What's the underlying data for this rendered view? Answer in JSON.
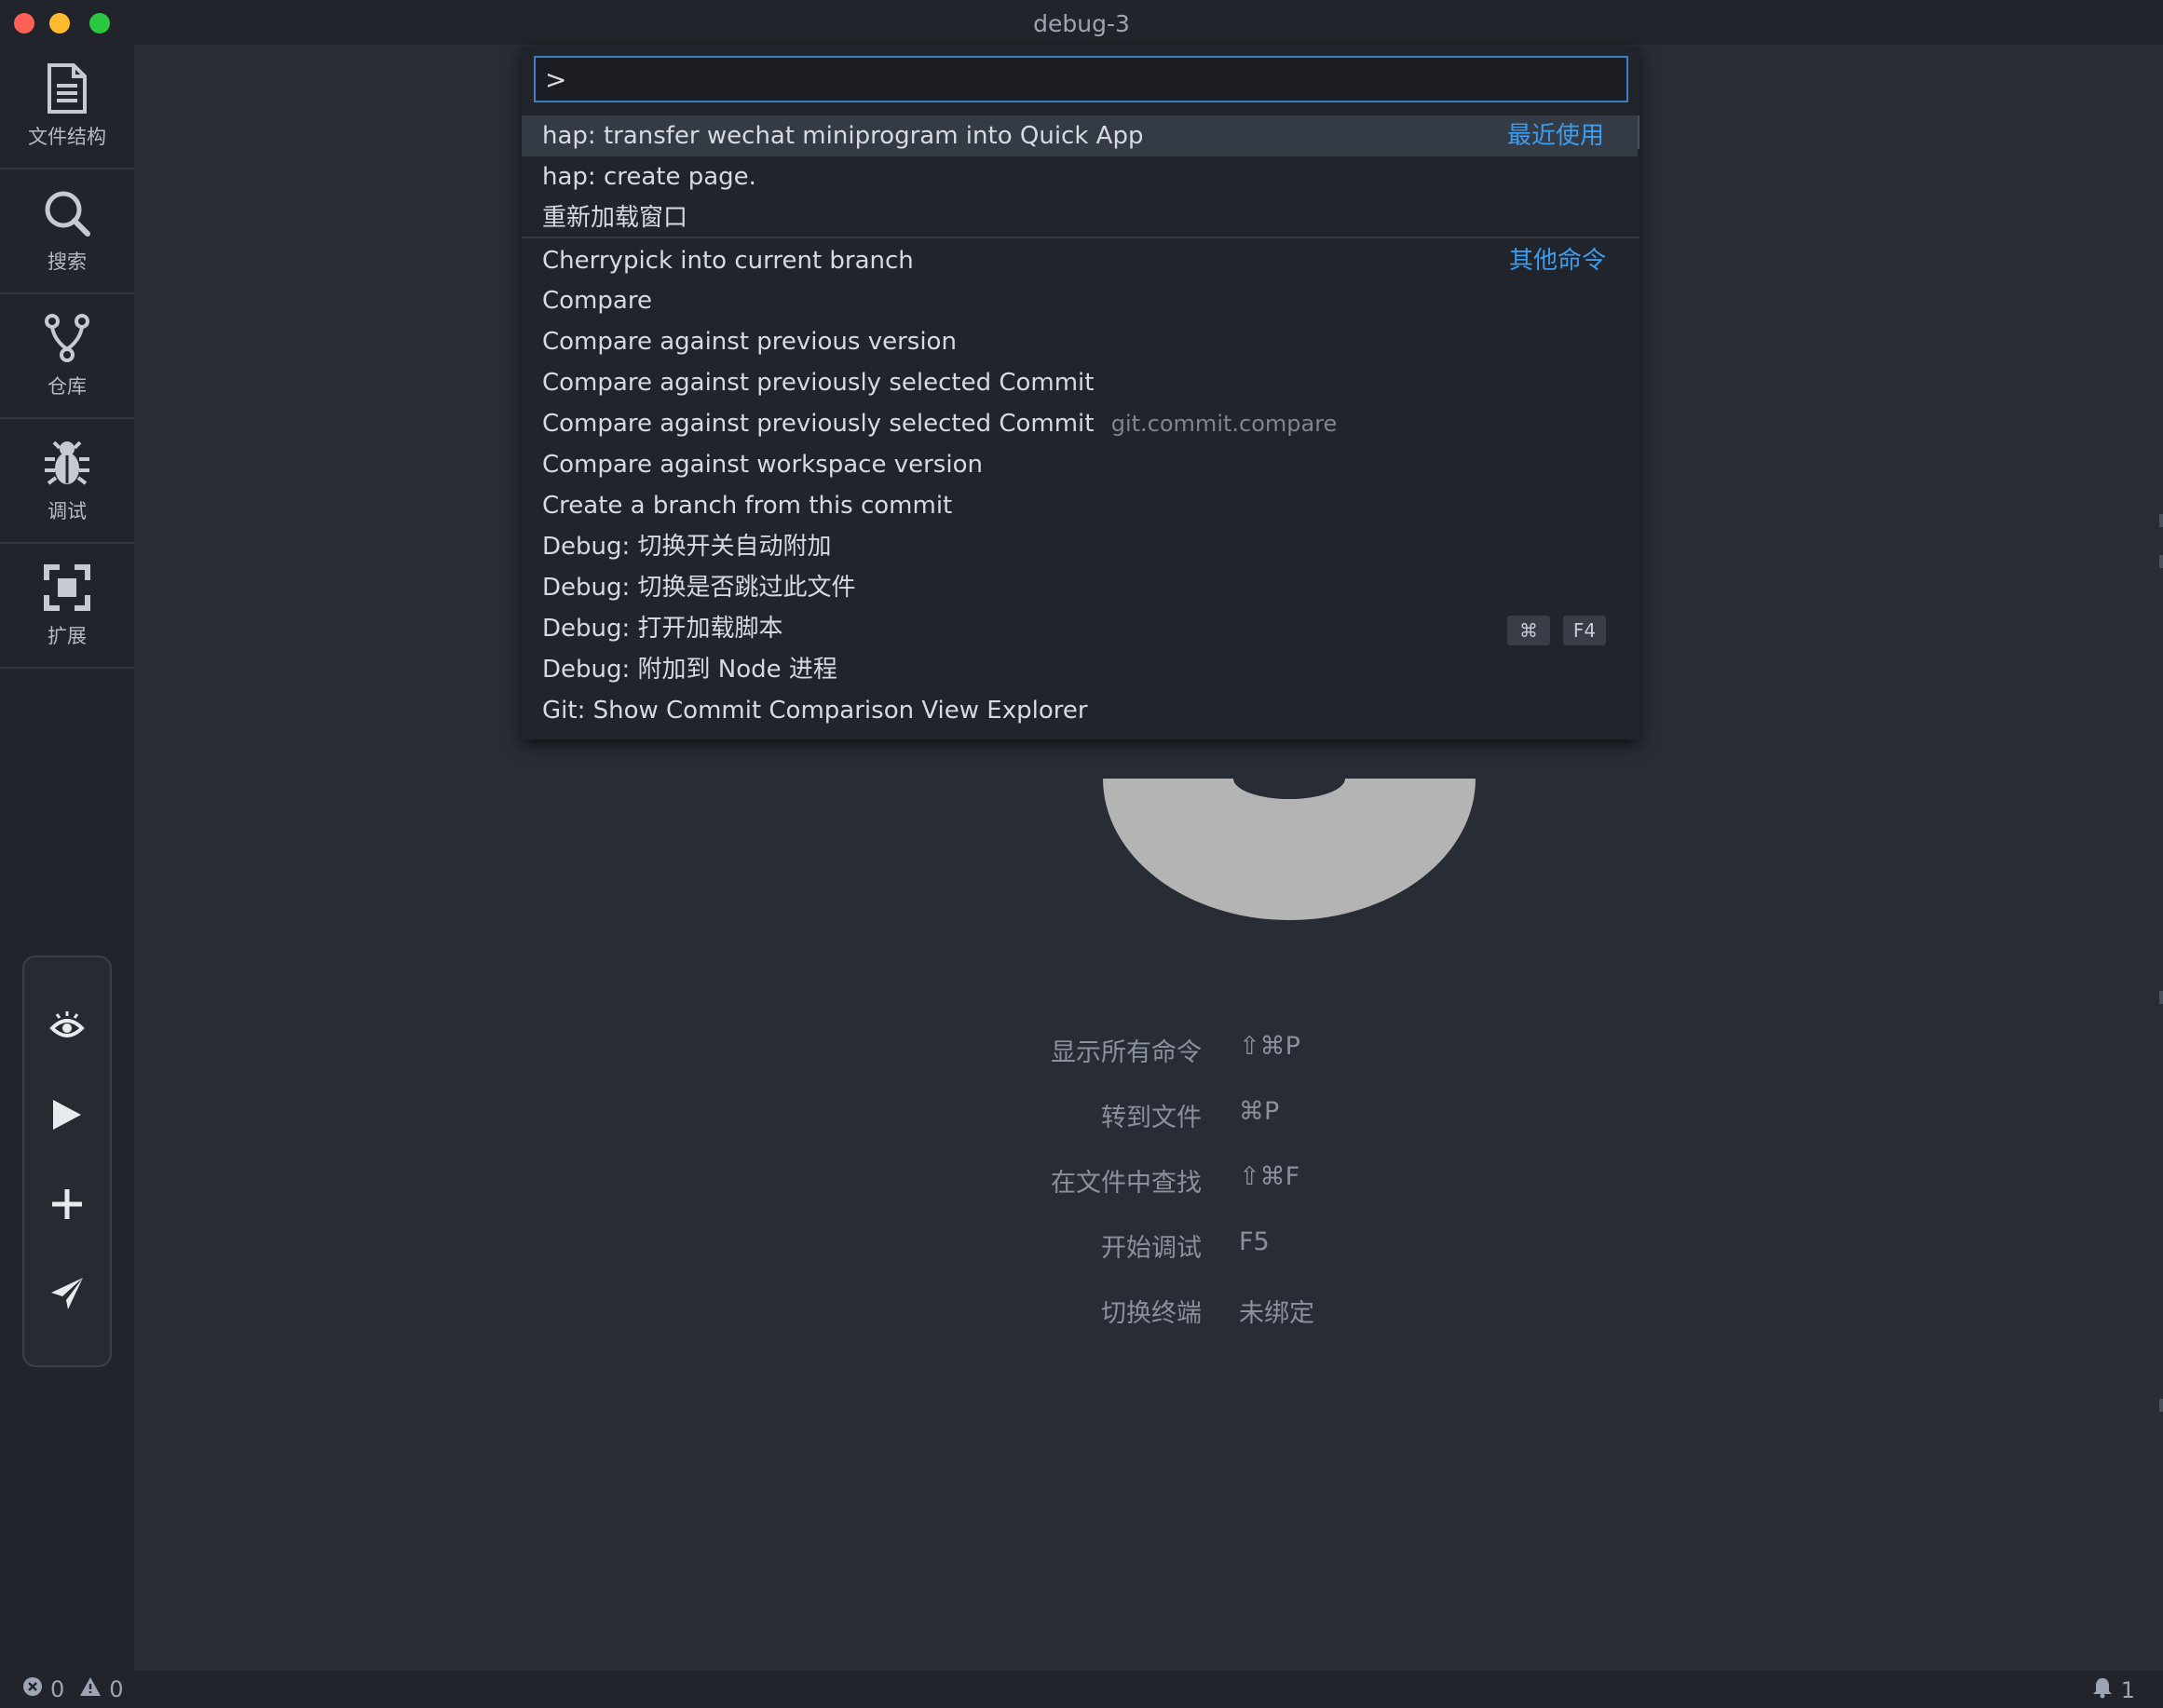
{
  "window": {
    "title": "debug-3"
  },
  "activity_bar": {
    "items": [
      {
        "label": "文件结构",
        "icon": "file-icon"
      },
      {
        "label": "搜索",
        "icon": "search-icon"
      },
      {
        "label": "仓库",
        "icon": "git-branch-icon"
      },
      {
        "label": "调试",
        "icon": "bug-icon"
      },
      {
        "label": "扩展",
        "icon": "extension-icon"
      }
    ],
    "tools": [
      "eye-icon",
      "play-icon",
      "plus-icon",
      "send-icon"
    ]
  },
  "command_palette": {
    "input_value": ">",
    "groups": {
      "recent": "最近使用",
      "other": "其他命令"
    },
    "items": [
      {
        "label": "hap: transfer wechat miniprogram into Quick App"
      },
      {
        "label": "hap: create page."
      },
      {
        "label": "重新加载窗口"
      },
      {
        "label": "Cherrypick into current branch"
      },
      {
        "label": "Compare"
      },
      {
        "label": "Compare against previous version"
      },
      {
        "label": "Compare against previously selected Commit"
      },
      {
        "label": "Compare against previously selected Commit",
        "description": "git.commit.compare"
      },
      {
        "label": "Compare against workspace version"
      },
      {
        "label": "Create a branch from this commit"
      },
      {
        "label": "Debug: 切换开关自动附加"
      },
      {
        "label": "Debug: 切换是否跳过此文件"
      },
      {
        "label": "Debug: 打开加载脚本",
        "keys": [
          "⌘",
          "F4"
        ]
      },
      {
        "label": "Debug: 附加到 Node 进程"
      },
      {
        "label": "Git: Show Commit Comparison View Explorer"
      }
    ]
  },
  "welcome_shortcuts": [
    {
      "name": "显示所有命令",
      "key": "⇧⌘P"
    },
    {
      "name": "转到文件",
      "key": "⌘P"
    },
    {
      "name": "在文件中查找",
      "key": "⇧⌘F"
    },
    {
      "name": "开始调试",
      "key": "F5"
    },
    {
      "name": "切换终端",
      "key": "未绑定"
    }
  ],
  "status_bar": {
    "errors": "0",
    "warnings": "0",
    "notifications": "1"
  },
  "colors": {
    "accent": "#3b9cf0",
    "background": "#282c34",
    "panel": "#21252b"
  }
}
